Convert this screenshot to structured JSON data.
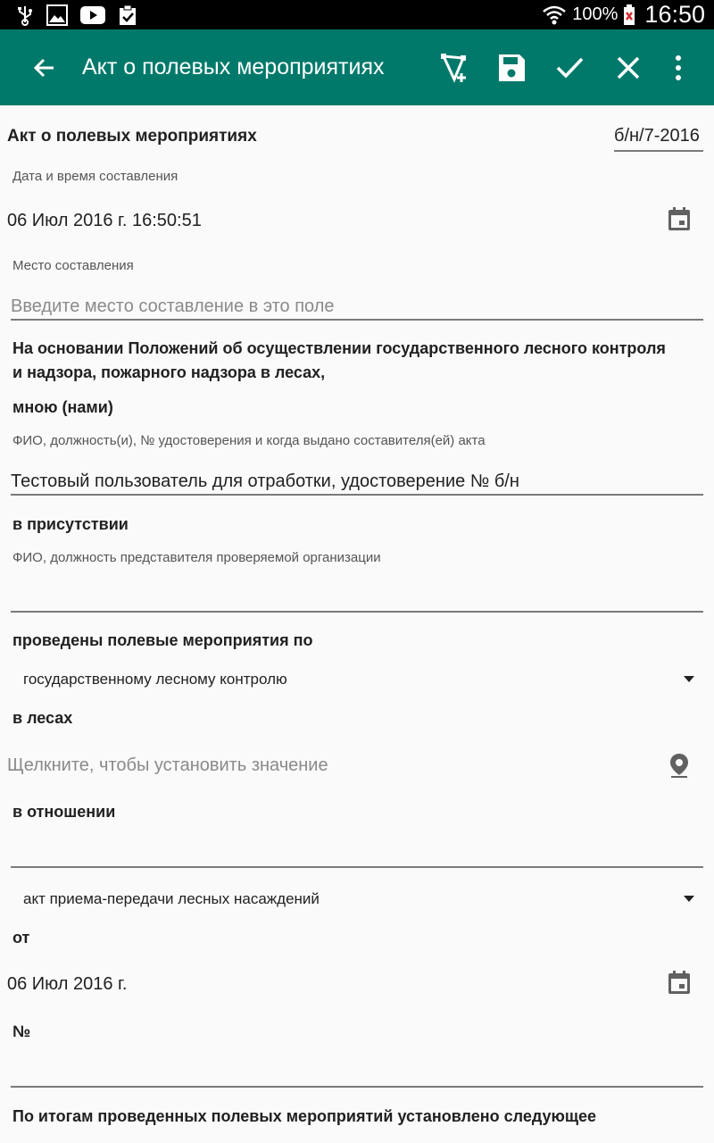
{
  "status_bar": {
    "battery": "100%",
    "time": "16:50"
  },
  "toolbar": {
    "title": "Акт о полевых мероприятиях",
    "icons": [
      "back-arrow-icon",
      "polygon-add-icon",
      "save-icon",
      "check-icon",
      "close-icon",
      "overflow-menu-icon"
    ]
  },
  "form": {
    "header_title": "Акт о полевых мероприятиях",
    "doc_number": "б/н/7-2016",
    "datetime_label": "Дата и время составления",
    "datetime_value": "06 Июл 2016 г. 16:50:51",
    "place_label": "Место составления",
    "place_placeholder": "Введите место составление в это поле",
    "basis_text_line1": "На основании Положений об осуществлении государственного лесного контроля",
    "basis_text_line2": "и надзора, пожарного надзора в лесах,",
    "by_me_label": "мною (нами)",
    "author_hint": "ФИО, должность(и), № удостоверения и когда выдано составителя(ей) акта",
    "author_value": "Тестовый пользователь для отработки, удостоверение № б/н",
    "presence_label": "в присутствии",
    "presence_hint": "ФИО, должность представителя проверяемой организации",
    "presence_value": "",
    "conducted_label": "проведены полевые мероприятия по",
    "conducted_value": "государственному лесному контролю",
    "forests_label": "в лесах",
    "forests_placeholder": "Щелкните, чтобы установить значение",
    "regarding_label": "в отношении",
    "regarding_value": "",
    "doc_type_value": "акт приема-передачи лесных насаждений",
    "from_label": "от",
    "from_date_value": "06 Июл 2016 г.",
    "number_label": "№",
    "number_value": "",
    "results_label": "По итогам проведенных полевых мероприятий установлено следующее"
  }
}
